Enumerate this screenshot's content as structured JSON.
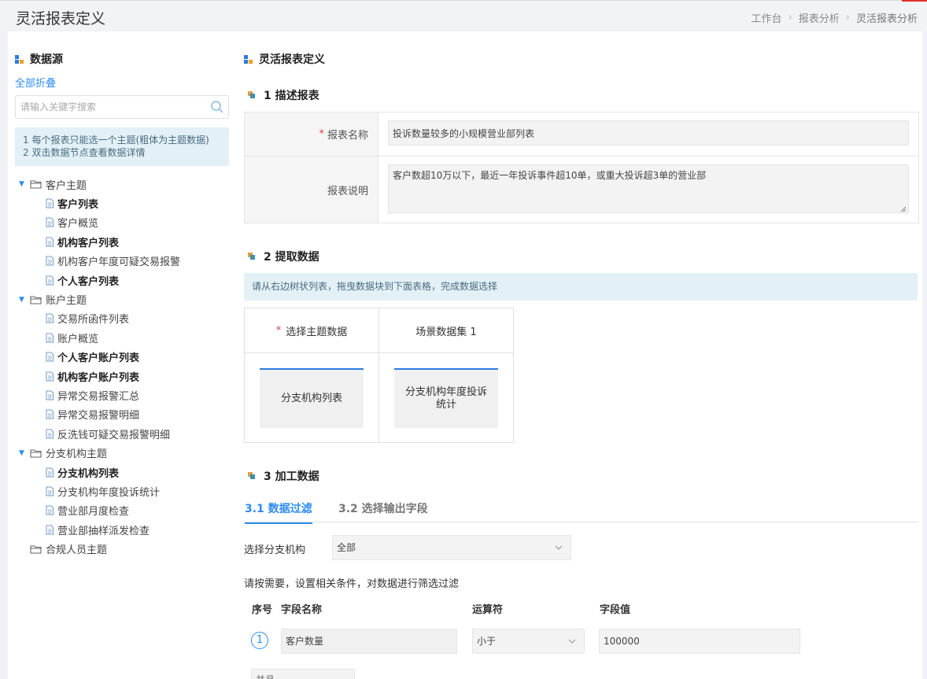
{
  "app": {
    "title": "灵活报表定义",
    "breadcrumb": [
      "工作台",
      "报表分析",
      "灵活报表分析"
    ]
  },
  "sidebar": {
    "title": "数据源",
    "collapse_all": "全部折叠",
    "search_placeholder": "请输入关键字搜索",
    "tips": [
      "1 每个报表只能选一个主题(粗体为主题数据)",
      "2 双击数据节点查看数据详情"
    ],
    "tree": [
      {
        "label": "客户主题",
        "expanded": true,
        "children": [
          {
            "label": "客户列表",
            "bold": true
          },
          {
            "label": "客户概览",
            "bold": false
          },
          {
            "label": "机构客户列表",
            "bold": true
          },
          {
            "label": "机构客户年度可疑交易报警",
            "bold": false
          },
          {
            "label": "个人客户列表",
            "bold": true
          }
        ]
      },
      {
        "label": "账户主题",
        "expanded": true,
        "children": [
          {
            "label": "交易所函件列表",
            "bold": false
          },
          {
            "label": "账户概览",
            "bold": false
          },
          {
            "label": "个人客户账户列表",
            "bold": true
          },
          {
            "label": "机构客户账户列表",
            "bold": true
          },
          {
            "label": "异常交易报警汇总",
            "bold": false
          },
          {
            "label": "异常交易报警明细",
            "bold": false
          },
          {
            "label": "反洗钱可疑交易报警明细",
            "bold": false
          }
        ]
      },
      {
        "label": "分支机构主题",
        "expanded": true,
        "children": [
          {
            "label": "分支机构列表",
            "bold": true
          },
          {
            "label": "分支机构年度投诉统计",
            "bold": false
          },
          {
            "label": "营业部月度检查",
            "bold": false
          },
          {
            "label": "营业部抽样派发检查",
            "bold": false
          }
        ]
      },
      {
        "label": "合规人员主题",
        "expanded": false,
        "children": []
      }
    ]
  },
  "main": {
    "title": "灵活报表定义",
    "step1": {
      "title": "1 描述报表",
      "name_label": "报表名称",
      "name_required": "*",
      "name_value": "投诉数量较多的小规模营业部列表",
      "desc_label": "报表说明",
      "desc_value": "客户数超10万以下，最近一年投诉事件超10单，或重大投诉超3单的营业部"
    },
    "step2": {
      "title": "2 提取数据",
      "hint": "请从右边树状列表，拖曳数据块到下面表格，完成数据选择",
      "columns": [
        {
          "header": "选择主题数据",
          "required": "*",
          "block": "分支机构列表"
        },
        {
          "header": "场景数据集 1",
          "required": "",
          "block": "分支机构年度投诉统计"
        }
      ]
    },
    "step3": {
      "title": "3 加工数据",
      "tabs": [
        "3.1 数据过滤",
        "3.2 选择输出字段"
      ],
      "branch_label": "选择分支机构",
      "branch_value": "全部",
      "filter_hint": "请按需要，设置相关条件，对数据进行筛选过滤",
      "cond_headers": {
        "index": "序号",
        "field": "字段名称",
        "op": "运算符",
        "value": "字段值"
      },
      "conditions": [
        {
          "index": "1",
          "field": "客户数量",
          "op": "小于",
          "value": "100000"
        }
      ],
      "logic_value": "并且"
    }
  },
  "colors": {
    "accent": "#2d8cf0",
    "required": "#e04040",
    "hint_bg": "#e3f1f7"
  }
}
